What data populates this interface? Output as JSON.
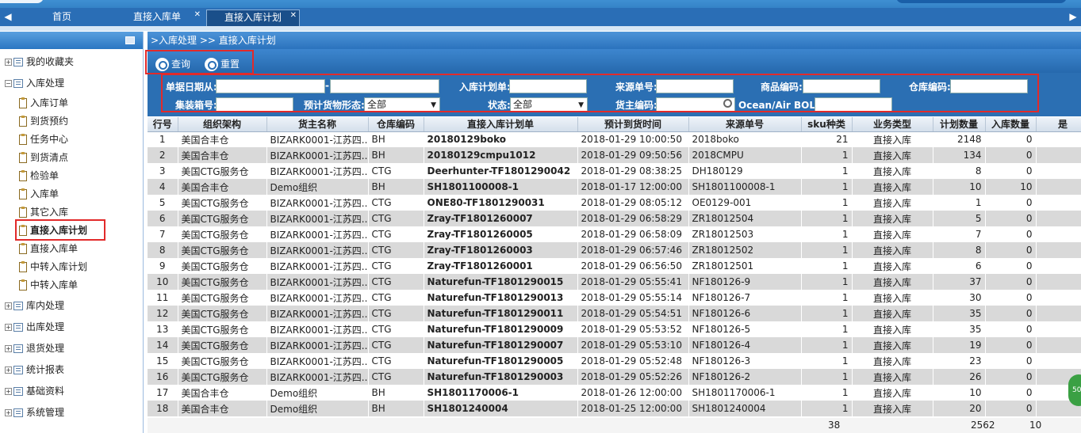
{
  "tabs": {
    "home": "首页",
    "direct_order": "直接入库单",
    "direct_plan": "直接入库计划"
  },
  "sidebar": {
    "favorites": "我的收藏夹",
    "inbound": "入库处理",
    "inbound_children": [
      "入库订单",
      "到货预约",
      "任务中心",
      "到货清点",
      "检验单",
      "入库单",
      "其它入库",
      "直接入库计划",
      "直接入库单",
      "中转入库计划",
      "中转入库单"
    ],
    "others": [
      "库内处理",
      "出库处理",
      "退货处理",
      "统计报表",
      "基础资料",
      "系统管理"
    ]
  },
  "breadcrumb": ">入库处理 >> 直接入库计划",
  "toolbar": {
    "query": "查询",
    "reset": "重置"
  },
  "filters": {
    "date_from": "单据日期从:",
    "date_sep": "-",
    "plan_no": "入库计划单:",
    "source_no": "来源单号:",
    "product_code": "商品编码:",
    "warehouse_code": "仓库编码:",
    "container_no": "集装箱号:",
    "cargo_form": "预计货物形态:",
    "cargo_form_value": "全部",
    "status": "状态:",
    "status_value": "全部",
    "owner_code": "货主编码:",
    "bol": "Ocean/Air BOL号:"
  },
  "columns": [
    "行号",
    "组织架构",
    "货主名称",
    "仓库编码",
    "直接入库计划单",
    "预计到货时间",
    "来源单号",
    "sku种类",
    "业务类型",
    "计划数量",
    "入库数量",
    "是"
  ],
  "rows": [
    [
      "1",
      "美国合丰仓",
      "BIZARK0001-江苏四...",
      "BH",
      "20180129boko",
      "2018-01-29 10:00:50",
      "2018boko",
      "21",
      "直接入库",
      "2148",
      "0"
    ],
    [
      "2",
      "美国合丰仓",
      "BIZARK0001-江苏四...",
      "BH",
      "20180129cmpu1012",
      "2018-01-29 09:50:56",
      "2018CMPU",
      "1",
      "直接入库",
      "134",
      "0"
    ],
    [
      "3",
      "美国CTG服务仓",
      "BIZARK0001-江苏四...",
      "CTG",
      "Deerhunter-TF1801290042",
      "2018-01-29 08:38:25",
      "DH180129",
      "1",
      "直接入库",
      "8",
      "0"
    ],
    [
      "4",
      "美国合丰仓",
      "Demo组织",
      "BH",
      "SH1801100008-1",
      "2018-01-17 12:00:00",
      "SH1801100008-1",
      "1",
      "直接入库",
      "10",
      "10"
    ],
    [
      "5",
      "美国CTG服务仓",
      "BIZARK0001-江苏四...",
      "CTG",
      "ONE80-TF1801290031",
      "2018-01-29 08:05:12",
      "OE0129-001",
      "1",
      "直接入库",
      "1",
      "0"
    ],
    [
      "6",
      "美国CTG服务仓",
      "BIZARK0001-江苏四...",
      "CTG",
      "Zray-TF1801260007",
      "2018-01-29 06:58:29",
      "ZR18012504",
      "1",
      "直接入库",
      "5",
      "0"
    ],
    [
      "7",
      "美国CTG服务仓",
      "BIZARK0001-江苏四...",
      "CTG",
      "Zray-TF1801260005",
      "2018-01-29 06:58:09",
      "ZR18012503",
      "1",
      "直接入库",
      "7",
      "0"
    ],
    [
      "8",
      "美国CTG服务仓",
      "BIZARK0001-江苏四...",
      "CTG",
      "Zray-TF1801260003",
      "2018-01-29 06:57:46",
      "ZR18012502",
      "1",
      "直接入库",
      "8",
      "0"
    ],
    [
      "9",
      "美国CTG服务仓",
      "BIZARK0001-江苏四...",
      "CTG",
      "Zray-TF1801260001",
      "2018-01-29 06:56:50",
      "ZR18012501",
      "1",
      "直接入库",
      "6",
      "0"
    ],
    [
      "10",
      "美国CTG服务仓",
      "BIZARK0001-江苏四...",
      "CTG",
      "Naturefun-TF1801290015",
      "2018-01-29 05:55:41",
      "NF180126-9",
      "1",
      "直接入库",
      "37",
      "0"
    ],
    [
      "11",
      "美国CTG服务仓",
      "BIZARK0001-江苏四...",
      "CTG",
      "Naturefun-TF1801290013",
      "2018-01-29 05:55:14",
      "NF180126-7",
      "1",
      "直接入库",
      "30",
      "0"
    ],
    [
      "12",
      "美国CTG服务仓",
      "BIZARK0001-江苏四...",
      "CTG",
      "Naturefun-TF1801290011",
      "2018-01-29 05:54:51",
      "NF180126-6",
      "1",
      "直接入库",
      "35",
      "0"
    ],
    [
      "13",
      "美国CTG服务仓",
      "BIZARK0001-江苏四...",
      "CTG",
      "Naturefun-TF1801290009",
      "2018-01-29 05:53:52",
      "NF180126-5",
      "1",
      "直接入库",
      "35",
      "0"
    ],
    [
      "14",
      "美国CTG服务仓",
      "BIZARK0001-江苏四...",
      "CTG",
      "Naturefun-TF1801290007",
      "2018-01-29 05:53:10",
      "NF180126-4",
      "1",
      "直接入库",
      "19",
      "0"
    ],
    [
      "15",
      "美国CTG服务仓",
      "BIZARK0001-江苏四...",
      "CTG",
      "Naturefun-TF1801290005",
      "2018-01-29 05:52:48",
      "NF180126-3",
      "1",
      "直接入库",
      "23",
      "0"
    ],
    [
      "16",
      "美国CTG服务仓",
      "BIZARK0001-江苏四...",
      "CTG",
      "Naturefun-TF1801290003",
      "2018-01-29 05:52:26",
      "NF180126-2",
      "1",
      "直接入库",
      "26",
      "0"
    ],
    [
      "17",
      "美国合丰仓",
      "Demo组织",
      "BH",
      "SH1801170006-1",
      "2018-01-26 12:00:00",
      "SH1801170006-1",
      "1",
      "直接入库",
      "10",
      "0"
    ],
    [
      "18",
      "美国合丰仓",
      "Demo组织",
      "BH",
      "SH1801240004",
      "2018-01-25 12:00:00",
      "SH1801240004",
      "1",
      "直接入库",
      "20",
      "0"
    ]
  ],
  "totals": {
    "sku": "38",
    "plan_qty": "2562",
    "in_qty": "10"
  },
  "floating_badge": "50"
}
